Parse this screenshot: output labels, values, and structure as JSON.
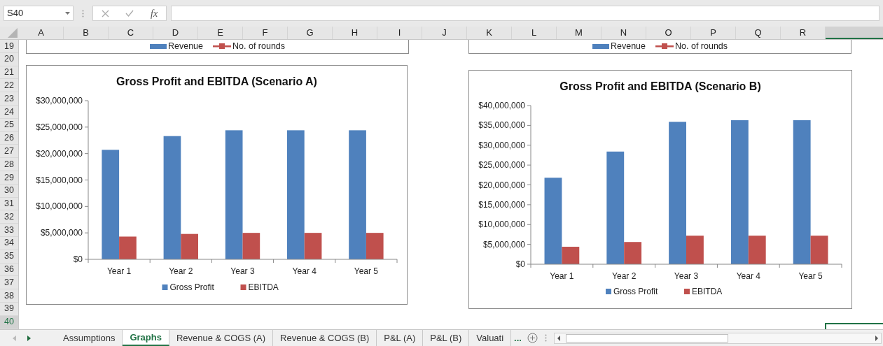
{
  "formula_bar": {
    "name_box": "S40",
    "function_label": "fx"
  },
  "columns": [
    "A",
    "B",
    "C",
    "D",
    "E",
    "F",
    "G",
    "H",
    "I",
    "J",
    "K",
    "L",
    "M",
    "N",
    "O",
    "P",
    "Q",
    "R"
  ],
  "rows": [
    {
      "label": "19",
      "selected": false
    },
    {
      "label": "20",
      "selected": false
    },
    {
      "label": "21",
      "selected": false
    },
    {
      "label": "22",
      "selected": false
    },
    {
      "label": "23",
      "selected": false
    },
    {
      "label": "24",
      "selected": false
    },
    {
      "label": "25",
      "selected": false
    },
    {
      "label": "26",
      "selected": false
    },
    {
      "label": "27",
      "selected": false
    },
    {
      "label": "28",
      "selected": false
    },
    {
      "label": "29",
      "selected": false
    },
    {
      "label": "30",
      "selected": false
    },
    {
      "label": "31",
      "selected": false
    },
    {
      "label": "32",
      "selected": false
    },
    {
      "label": "33",
      "selected": false
    },
    {
      "label": "34",
      "selected": false
    },
    {
      "label": "35",
      "selected": false
    },
    {
      "label": "36",
      "selected": false
    },
    {
      "label": "37",
      "selected": false
    },
    {
      "label": "38",
      "selected": false
    },
    {
      "label": "39",
      "selected": false
    },
    {
      "label": "40",
      "selected": true
    }
  ],
  "partial_charts": [
    {
      "legend": [
        {
          "name": "Revenue",
          "color": "#4f81bd",
          "kind": "bar"
        },
        {
          "name": "No. of rounds",
          "color": "#c0504d",
          "kind": "line"
        }
      ]
    },
    {
      "legend": [
        {
          "name": "Revenue",
          "color": "#4f81bd",
          "kind": "bar"
        },
        {
          "name": "No. of rounds",
          "color": "#c0504d",
          "kind": "line"
        }
      ]
    }
  ],
  "charts": [
    {
      "chart_data": {
        "type": "bar",
        "title": "Gross Profit and EBITDA (Scenario A)",
        "categories": [
          "Year 1",
          "Year 2",
          "Year 3",
          "Year 4",
          "Year 5"
        ],
        "series": [
          {
            "name": "Gross Profit",
            "color": "#4f81bd",
            "values": [
              20700000,
              23300000,
              24400000,
              24400000,
              24400000
            ]
          },
          {
            "name": "EBITDA",
            "color": "#c0504d",
            "values": [
              4300000,
              4800000,
              5000000,
              5000000,
              5000000
            ]
          }
        ],
        "legend": "bottom",
        "ylim": [
          0,
          30000000
        ],
        "yticks": [
          {
            "value": 0,
            "label": "$0"
          },
          {
            "value": 5000000,
            "label": "$5,000,000"
          },
          {
            "value": 10000000,
            "label": "$10,000,000"
          },
          {
            "value": 15000000,
            "label": "$15,000,000"
          },
          {
            "value": 20000000,
            "label": "$20,000,000"
          },
          {
            "value": 25000000,
            "label": "$25,000,000"
          },
          {
            "value": 30000000,
            "label": "$30,000,000"
          }
        ]
      }
    },
    {
      "chart_data": {
        "type": "bar",
        "title": "Gross Profit and EBITDA (Scenario B)",
        "categories": [
          "Year 1",
          "Year 2",
          "Year 3",
          "Year 4",
          "Year 5"
        ],
        "series": [
          {
            "name": "Gross Profit",
            "color": "#4f81bd",
            "values": [
              21800000,
              28400000,
              35900000,
              36300000,
              36300000
            ]
          },
          {
            "name": "EBITDA",
            "color": "#c0504d",
            "values": [
              4400000,
              5600000,
              7200000,
              7200000,
              7200000
            ]
          }
        ],
        "legend": "bottom",
        "ylim": [
          0,
          40000000
        ],
        "yticks": [
          {
            "value": 0,
            "label": "$0"
          },
          {
            "value": 5000000,
            "label": "$5,000,000"
          },
          {
            "value": 10000000,
            "label": "$10,000,000"
          },
          {
            "value": 15000000,
            "label": "$15,000,000"
          },
          {
            "value": 20000000,
            "label": "$20,000,000"
          },
          {
            "value": 25000000,
            "label": "$25,000,000"
          },
          {
            "value": 30000000,
            "label": "$30,000,000"
          },
          {
            "value": 35000000,
            "label": "$35,000,000"
          },
          {
            "value": 40000000,
            "label": "$40,000,000"
          }
        ]
      }
    }
  ],
  "sheet_tabs": [
    {
      "label": "Assumptions",
      "selected": false
    },
    {
      "label": "Graphs",
      "selected": true
    },
    {
      "label": "Revenue & COGS (A)",
      "selected": false
    },
    {
      "label": "Revenue & COGS (B)",
      "selected": false
    },
    {
      "label": "P&L (A)",
      "selected": false
    },
    {
      "label": "P&L (B)",
      "selected": false
    },
    {
      "label": "Valuati",
      "selected": false
    }
  ],
  "more_tabs": "..."
}
